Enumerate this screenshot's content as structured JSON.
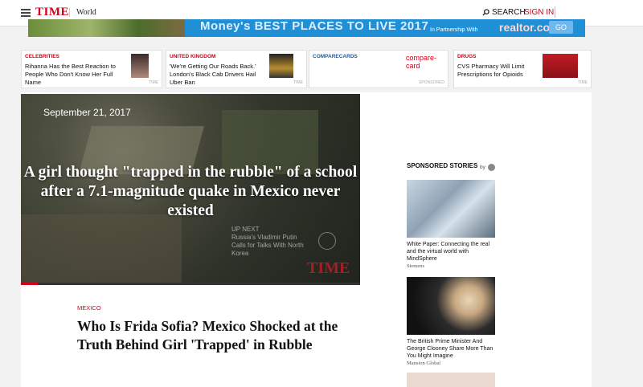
{
  "header": {
    "logo": "TIME",
    "section": "World",
    "search_label": "SEARCH",
    "signin_label": "SIGN IN"
  },
  "banner": {
    "headline": "Money's  BEST PLACES TO LIVE 2017",
    "partner_text": "In Partnership With",
    "partner_brand": "realtor.com",
    "go_label": "GO"
  },
  "cards": [
    {
      "category": "CELEBRITIES",
      "headline": "Rihanna Has the Best Reaction to People Who Don't Know Her Full Name",
      "source": "TIME"
    },
    {
      "category": "UNITED KINGDOM",
      "headline": "'We're Getting Our Roads Back.' London's Black Cab Drivers Hail Uber Ban",
      "source": "TIME"
    },
    {
      "category": "COMPARECARDS",
      "logo": "compare-card",
      "source": "SPONSORED"
    },
    {
      "category": "DRUGS",
      "headline": "CVS Pharmacy Will Limit Prescriptions for Opioids",
      "source": "TIME"
    }
  ],
  "video": {
    "date": "September 21, 2017",
    "caption": "A girl thought \"trapped in the rubble\" of a school after a 7.1-magnitude quake in Mexico never existed",
    "up_next_label": "UP NEXT",
    "up_next_text": "Russia's Vladimir Putin Calls for Talks With North Korea",
    "watermark": "TIME",
    "progress": 0.05
  },
  "article": {
    "category": "MEXICO",
    "title": "Who Is Frida Sofia? Mexico Shocked at the Truth Behind Girl 'Trapped' in Rubble"
  },
  "sponsored": {
    "heading": "SPONSORED STORIES",
    "by_label": "by",
    "stories": [
      {
        "text": "White Paper: Connecting the real and the virtual world with MindSphere",
        "source": "Siemens"
      },
      {
        "text": "The British Prime Minister And George Clooney Share More Than You Might Imagine",
        "source": "Mansion Global"
      }
    ]
  },
  "colors": {
    "accent": "#d0021b",
    "banner": "#1f8fd6"
  }
}
